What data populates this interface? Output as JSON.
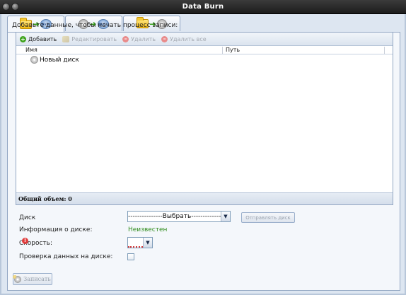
{
  "window": {
    "title": "Data Burn"
  },
  "tabs": [
    {
      "icons": [
        "folder-icon",
        "arrow-right-icon",
        "dvd-disc-icon"
      ],
      "active": true
    },
    {
      "icons": [
        "disc-icon",
        "arrow-right-icon",
        "dvd-disc-icon"
      ],
      "active": false
    },
    {
      "icons": [
        "folder-icon",
        "arrow-right-icon",
        "disc-icon"
      ],
      "active": false
    }
  ],
  "main": {
    "instruction": "Добавьте данные, чтобы начать процесс записи:",
    "toolbar": {
      "add_label": "Добавить",
      "edit_label": "Редактировать",
      "delete_label": "Удалить",
      "delete_all_label": "Удалить все"
    },
    "columns": {
      "name": "Имя",
      "path": "Путь"
    },
    "tree": {
      "root_label": "Новый диск"
    },
    "summary": "Общий объем: 0"
  },
  "form": {
    "disk_label": "Диск",
    "disk_select_value": "---------------Выбрать---------------",
    "eject_label": "Отправлять диск",
    "disk_info_label": "Информация о диске:",
    "disk_info_value": "Неизвестен",
    "speed_label": "Скорость:",
    "speed_value": "",
    "verify_label": "Проверка данных на диске:",
    "verify_checked": false
  },
  "actions": {
    "burn_label": "Записать"
  },
  "colors": {
    "status_ok": "#2f8c1c",
    "titlebar": "#1c1c1c",
    "accent_green": "#3ea31c",
    "warn_red": "#e03b3b"
  }
}
